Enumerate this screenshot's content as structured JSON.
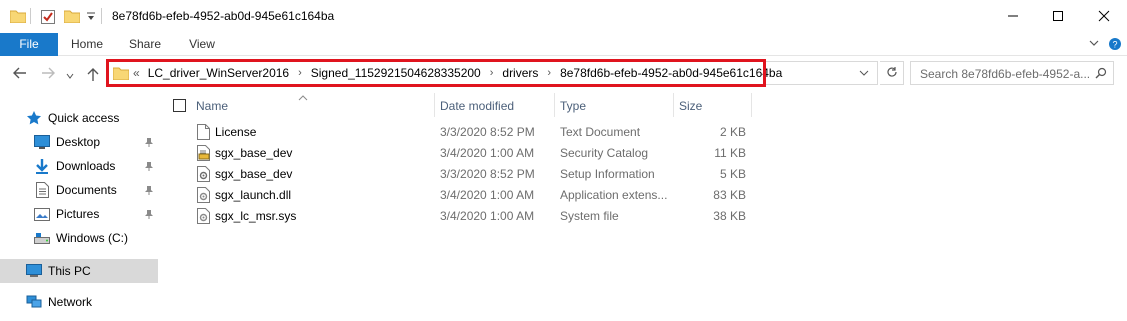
{
  "window": {
    "title": "8e78fd6b-efeb-4952-ab0d-945e61c164ba"
  },
  "ribbon": {
    "tabs": [
      {
        "label": "File"
      },
      {
        "label": "Home"
      },
      {
        "label": "Share"
      },
      {
        "label": "View"
      }
    ]
  },
  "address": {
    "lead": "«",
    "crumbs": [
      "LC_driver_WinServer2016",
      "Signed_1152921504628335200",
      "drivers",
      "8e78fd6b-efeb-4952-ab0d-945e61c164ba"
    ],
    "separator": "›",
    "highlight_color": "#e0141e"
  },
  "search": {
    "placeholder": "Search 8e78fd6b-efeb-4952-a..."
  },
  "navpane": {
    "quick_access": "Quick access",
    "items": [
      {
        "label": "Desktop",
        "icon": "desktop-icon",
        "pinned": true
      },
      {
        "label": "Downloads",
        "icon": "downloads-icon",
        "pinned": true
      },
      {
        "label": "Documents",
        "icon": "documents-icon",
        "pinned": true
      },
      {
        "label": "Pictures",
        "icon": "pictures-icon",
        "pinned": true
      },
      {
        "label": "Windows (C:)",
        "icon": "drive-icon",
        "pinned": false
      }
    ],
    "this_pc": "This PC",
    "network": "Network"
  },
  "columns": {
    "name": "Name",
    "date": "Date modified",
    "type": "Type",
    "size": "Size"
  },
  "files": [
    {
      "name": "License",
      "date": "3/3/2020 8:52 PM",
      "type": "Text Document",
      "size": "2 KB",
      "icon": "text-file-icon"
    },
    {
      "name": "sgx_base_dev",
      "date": "3/4/2020 1:00 AM",
      "type": "Security Catalog",
      "size": "11 KB",
      "icon": "catalog-file-icon"
    },
    {
      "name": "sgx_base_dev",
      "date": "3/3/2020 8:52 PM",
      "type": "Setup Information",
      "size": "5 KB",
      "icon": "setup-file-icon"
    },
    {
      "name": "sgx_launch.dll",
      "date": "3/4/2020 1:00 AM",
      "type": "Application extens...",
      "size": "83 KB",
      "icon": "dll-file-icon"
    },
    {
      "name": "sgx_lc_msr.sys",
      "date": "3/4/2020 1:00 AM",
      "type": "System file",
      "size": "38 KB",
      "icon": "sys-file-icon"
    }
  ],
  "colors": {
    "file_tab": "#1979ca",
    "selection_bg": "#d9d9d9",
    "header_text": "#4c607a"
  }
}
